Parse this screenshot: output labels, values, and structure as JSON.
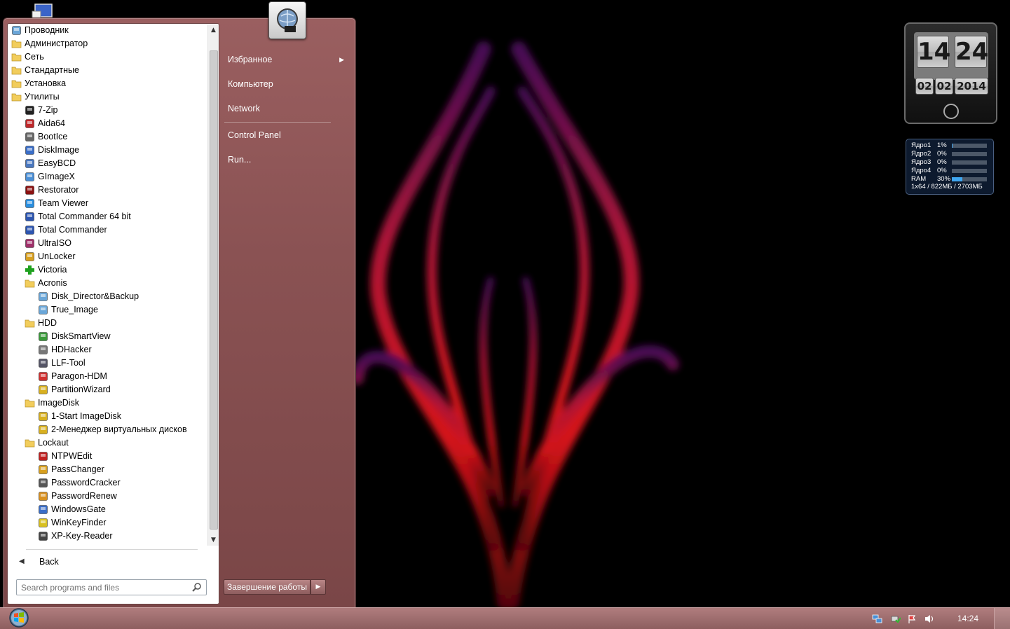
{
  "start_menu": {
    "programs": [
      {
        "label": "Проводник",
        "level": 0,
        "icon": "explorer-icon"
      },
      {
        "label": "Администратор",
        "level": 0,
        "icon": "folder-icon"
      },
      {
        "label": "Сеть",
        "level": 0,
        "icon": "folder-icon"
      },
      {
        "label": "Стандартные",
        "level": 0,
        "icon": "folder-icon"
      },
      {
        "label": "Установка",
        "level": 0,
        "icon": "folder-icon"
      },
      {
        "label": "Утилиты",
        "level": 0,
        "icon": "folder-icon"
      },
      {
        "label": "7-Zip",
        "level": 1,
        "icon": "7zip-icon"
      },
      {
        "label": "Aida64",
        "level": 1,
        "icon": "aida64-icon"
      },
      {
        "label": "BootIce",
        "level": 1,
        "icon": "bootice-icon"
      },
      {
        "label": "DiskImage",
        "level": 1,
        "icon": "diskimage-icon"
      },
      {
        "label": "EasyBCD",
        "level": 1,
        "icon": "easybcd-icon"
      },
      {
        "label": "GImageX",
        "level": 1,
        "icon": "gimagex-icon"
      },
      {
        "label": "Restorator",
        "level": 1,
        "icon": "restorator-icon"
      },
      {
        "label": "Team Viewer",
        "level": 1,
        "icon": "teamviewer-icon"
      },
      {
        "label": "Total Commander 64 bit",
        "level": 1,
        "icon": "floppy-icon"
      },
      {
        "label": "Total Commander",
        "level": 1,
        "icon": "floppy-icon"
      },
      {
        "label": "UltraISO",
        "level": 1,
        "icon": "ultraiso-icon"
      },
      {
        "label": "UnLocker",
        "level": 1,
        "icon": "unlocker-icon"
      },
      {
        "label": "Victoria",
        "level": 1,
        "icon": "green-cross-icon"
      },
      {
        "label": "Acronis",
        "level": 1,
        "icon": "folder-icon"
      },
      {
        "label": "Disk_Director&Backup",
        "level": 2,
        "icon": "acronis-icon"
      },
      {
        "label": "True_Image",
        "level": 2,
        "icon": "acronis-icon"
      },
      {
        "label": "HDD",
        "level": 1,
        "icon": "folder-icon"
      },
      {
        "label": "DiskSmartView",
        "level": 2,
        "icon": "disksmartview-icon"
      },
      {
        "label": "HDHacker",
        "level": 2,
        "icon": "hdhacker-icon"
      },
      {
        "label": "LLF-Tool",
        "level": 2,
        "icon": "llftool-icon"
      },
      {
        "label": "Paragon-HDM",
        "level": 2,
        "icon": "paragon-icon"
      },
      {
        "label": "PartitionWizard",
        "level": 2,
        "icon": "partitionwizard-icon"
      },
      {
        "label": "ImageDisk",
        "level": 1,
        "icon": "folder-icon"
      },
      {
        "label": "1-Start ImageDisk",
        "level": 2,
        "icon": "disc-icon"
      },
      {
        "label": "2-Менеджер виртуальных дисков",
        "level": 2,
        "icon": "disc-icon"
      },
      {
        "label": "Lockaut",
        "level": 1,
        "icon": "folder-icon"
      },
      {
        "label": "NTPWEdit",
        "level": 2,
        "icon": "ntpwedit-icon"
      },
      {
        "label": "PassChanger",
        "level": 2,
        "icon": "key-icon"
      },
      {
        "label": "PasswordCracker",
        "level": 2,
        "icon": "passwordcracker-icon"
      },
      {
        "label": "PasswordRenew",
        "level": 2,
        "icon": "passwordrenew-icon"
      },
      {
        "label": "WindowsGate",
        "level": 2,
        "icon": "windowsgate-icon"
      },
      {
        "label": "WinKeyFinder",
        "level": 2,
        "icon": "winkeyfinder-icon"
      },
      {
        "label": "XP-Key-Reader",
        "level": 2,
        "icon": "key-reader-icon"
      }
    ],
    "back_label": "Back",
    "search_placeholder": "Search programs and files",
    "right_items": [
      {
        "label": "Избранное",
        "has_submenu": true
      },
      {
        "label": "Компьютер",
        "has_submenu": false
      },
      {
        "label": "Network",
        "has_submenu": false
      },
      {
        "label": "Control Panel",
        "has_submenu": false
      },
      {
        "label": "Run...",
        "has_submenu": false
      }
    ],
    "shutdown_label": "Завершение работы"
  },
  "clock_gadget": {
    "hours": "14",
    "minutes": "24",
    "day": "02",
    "month": "02",
    "year": "2014"
  },
  "cpu_gadget": {
    "rows": [
      {
        "name": "Ядро1",
        "percent_label": "1%",
        "value": 1
      },
      {
        "name": "Ядро2",
        "percent_label": "0%",
        "value": 0
      },
      {
        "name": "Ядро3",
        "percent_label": "0%",
        "value": 0
      },
      {
        "name": "Ядро4",
        "percent_label": "0%",
        "value": 0
      },
      {
        "name": "RAM",
        "percent_label": "30%",
        "value": 30
      }
    ],
    "footer": "1x64 / 822МБ / 2703МБ"
  },
  "taskbar": {
    "time": "14:24"
  },
  "colors": {
    "menu_accent": "#8a5253",
    "taskbar": "#a06f70",
    "cpu_bar": "#3fa6f0"
  }
}
